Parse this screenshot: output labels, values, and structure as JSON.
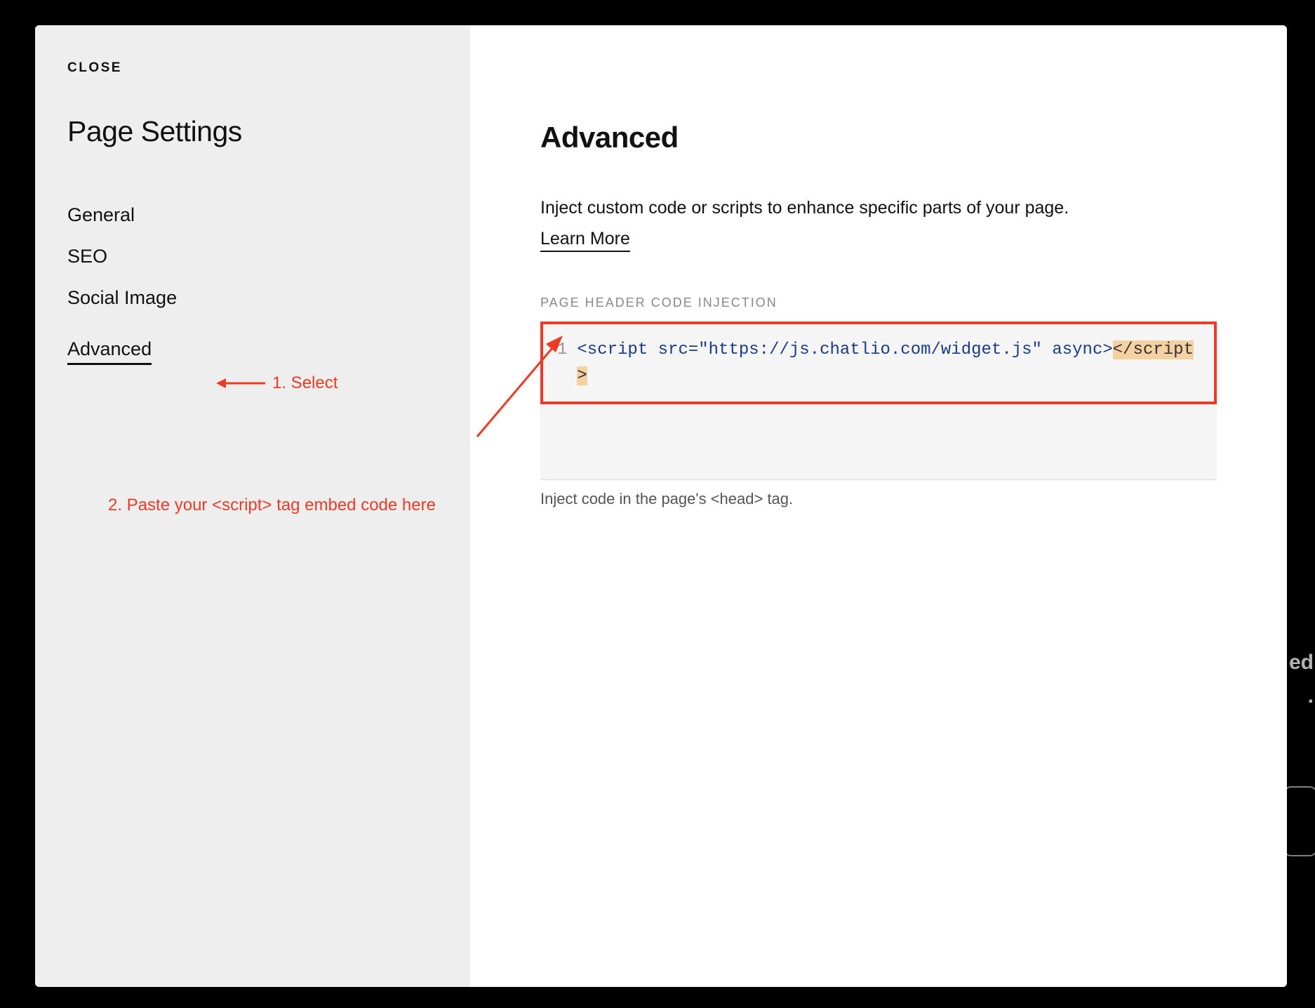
{
  "sidebar": {
    "close_label": "CLOSE",
    "title": "Page Settings",
    "nav": [
      {
        "label": "General",
        "active": false
      },
      {
        "label": "SEO",
        "active": false
      },
      {
        "label": "Social Image",
        "active": false
      },
      {
        "label": "Advanced",
        "active": true
      }
    ]
  },
  "main": {
    "heading": "Advanced",
    "description": "Inject custom code or scripts to enhance specific parts of your page.",
    "learn_more_label": "Learn More",
    "injection_label": "PAGE HEADER CODE INJECTION",
    "code": {
      "line_number": "1",
      "tag_open": "<script",
      "attr_src_name": " src=",
      "attr_src_value": "\"https://js.chatlio.com/widget.js\"",
      "attr_async": "async",
      "gt": ">",
      "tag_close": "</script>"
    },
    "helper_text": "Inject code in the page's <head> tag."
  },
  "annotations": {
    "step1": "1. Select",
    "step2": "2. Paste your <script> tag embed code here"
  },
  "colors": {
    "annotation": "#ee3a24",
    "sidebar_bg": "#eeeeee"
  },
  "edge": {
    "line1": "ed",
    "line2": "."
  }
}
